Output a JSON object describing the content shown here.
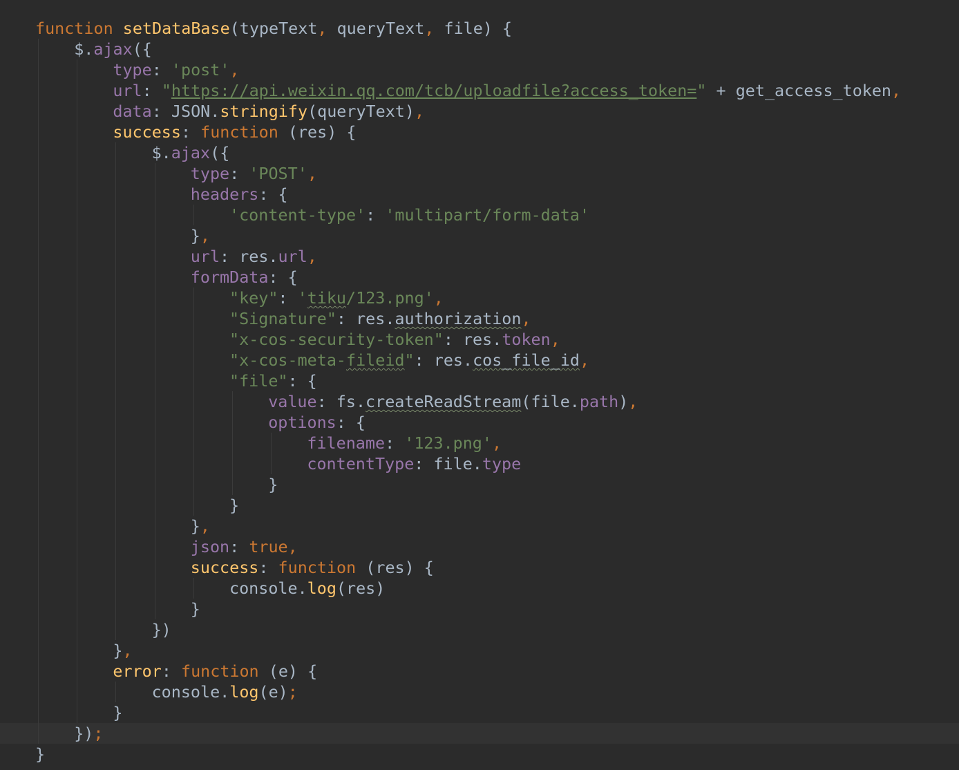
{
  "editor": {
    "theme": "darcula",
    "colors": {
      "background": "#2b2b2b",
      "current_line": "#323232",
      "keyword": "#cc7832",
      "function_name": "#ffc66d",
      "string": "#6a8759",
      "property": "#9876aa",
      "plain": "#a9b7c6"
    },
    "current_line_index": 34,
    "lines": [
      {
        "indent": 0,
        "tokens": [
          {
            "t": "function",
            "c": "kw"
          },
          {
            "t": " ",
            "c": "pl"
          },
          {
            "t": "setDataBase",
            "c": "fn"
          },
          {
            "t": "(typeText",
            "c": "pl"
          },
          {
            "t": ",",
            "c": "kw"
          },
          {
            "t": " queryText",
            "c": "pl"
          },
          {
            "t": ",",
            "c": "kw"
          },
          {
            "t": " file) {",
            "c": "pl"
          }
        ]
      },
      {
        "indent": 1,
        "tokens": [
          {
            "t": "$.",
            "c": "pl"
          },
          {
            "t": "ajax",
            "c": "prop"
          },
          {
            "t": "({",
            "c": "pl"
          }
        ]
      },
      {
        "indent": 2,
        "tokens": [
          {
            "t": "type",
            "c": "prop"
          },
          {
            "t": ": ",
            "c": "pl"
          },
          {
            "t": "'post'",
            "c": "str"
          },
          {
            "t": ",",
            "c": "kw"
          }
        ]
      },
      {
        "indent": 2,
        "tokens": [
          {
            "t": "url",
            "c": "prop"
          },
          {
            "t": ": ",
            "c": "pl"
          },
          {
            "t": "\"",
            "c": "str"
          },
          {
            "t": "https://api.weixin.qq.com/tcb/uploadfile?access_token=",
            "c": "url-link"
          },
          {
            "t": "\"",
            "c": "str"
          },
          {
            "t": " + get_access_token",
            "c": "pl"
          },
          {
            "t": ",",
            "c": "kw"
          }
        ]
      },
      {
        "indent": 2,
        "tokens": [
          {
            "t": "data",
            "c": "prop"
          },
          {
            "t": ": JSON.",
            "c": "pl"
          },
          {
            "t": "stringify",
            "c": "fn"
          },
          {
            "t": "(queryText)",
            "c": "pl"
          },
          {
            "t": ",",
            "c": "kw"
          }
        ]
      },
      {
        "indent": 2,
        "tokens": [
          {
            "t": "success",
            "c": "fn"
          },
          {
            "t": ": ",
            "c": "pl"
          },
          {
            "t": "function",
            "c": "kw"
          },
          {
            "t": " (res) {",
            "c": "pl"
          }
        ]
      },
      {
        "indent": 3,
        "tokens": [
          {
            "t": "$.",
            "c": "pl"
          },
          {
            "t": "ajax",
            "c": "prop"
          },
          {
            "t": "({",
            "c": "pl"
          }
        ]
      },
      {
        "indent": 4,
        "tokens": [
          {
            "t": "type",
            "c": "prop"
          },
          {
            "t": ": ",
            "c": "pl"
          },
          {
            "t": "'POST'",
            "c": "str"
          },
          {
            "t": ",",
            "c": "kw"
          }
        ]
      },
      {
        "indent": 4,
        "tokens": [
          {
            "t": "headers",
            "c": "prop"
          },
          {
            "t": ": {",
            "c": "pl"
          }
        ]
      },
      {
        "indent": 5,
        "tokens": [
          {
            "t": "'content-type'",
            "c": "str"
          },
          {
            "t": ": ",
            "c": "pl"
          },
          {
            "t": "'multipart/form-data'",
            "c": "str"
          }
        ]
      },
      {
        "indent": 4,
        "tokens": [
          {
            "t": "}",
            "c": "pl"
          },
          {
            "t": ",",
            "c": "kw"
          }
        ]
      },
      {
        "indent": 4,
        "tokens": [
          {
            "t": "url",
            "c": "prop"
          },
          {
            "t": ": res.",
            "c": "pl"
          },
          {
            "t": "url",
            "c": "prop"
          },
          {
            "t": ",",
            "c": "kw"
          }
        ]
      },
      {
        "indent": 4,
        "tokens": [
          {
            "t": "formData",
            "c": "prop"
          },
          {
            "t": ": {",
            "c": "pl"
          }
        ]
      },
      {
        "indent": 5,
        "tokens": [
          {
            "t": "\"key\"",
            "c": "str"
          },
          {
            "t": ": ",
            "c": "pl"
          },
          {
            "t": "'",
            "c": "str"
          },
          {
            "t": "tiku",
            "c": "str",
            "w": true
          },
          {
            "t": "/123.png'",
            "c": "str"
          },
          {
            "t": ",",
            "c": "kw"
          }
        ]
      },
      {
        "indent": 5,
        "tokens": [
          {
            "t": "\"Signature\"",
            "c": "str"
          },
          {
            "t": ": res.",
            "c": "pl"
          },
          {
            "t": "authorization",
            "c": "pl",
            "w": true
          },
          {
            "t": ",",
            "c": "kw"
          }
        ]
      },
      {
        "indent": 5,
        "tokens": [
          {
            "t": "\"x-cos-security-token\"",
            "c": "str"
          },
          {
            "t": ": res.",
            "c": "pl"
          },
          {
            "t": "token",
            "c": "prop"
          },
          {
            "t": ",",
            "c": "kw"
          }
        ]
      },
      {
        "indent": 5,
        "tokens": [
          {
            "t": "\"x-cos-meta-",
            "c": "str"
          },
          {
            "t": "fileid",
            "c": "str",
            "w": true
          },
          {
            "t": "\"",
            "c": "str"
          },
          {
            "t": ": res.",
            "c": "pl"
          },
          {
            "t": "cos_file_id",
            "c": "pl",
            "w": true
          },
          {
            "t": ",",
            "c": "kw"
          }
        ]
      },
      {
        "indent": 5,
        "tokens": [
          {
            "t": "\"file\"",
            "c": "str"
          },
          {
            "t": ": {",
            "c": "pl"
          }
        ]
      },
      {
        "indent": 6,
        "tokens": [
          {
            "t": "value",
            "c": "prop"
          },
          {
            "t": ": fs.",
            "c": "pl"
          },
          {
            "t": "createReadStream",
            "c": "pl",
            "w": true
          },
          {
            "t": "(file.",
            "c": "pl"
          },
          {
            "t": "path",
            "c": "prop"
          },
          {
            "t": ")",
            "c": "pl"
          },
          {
            "t": ",",
            "c": "kw"
          }
        ]
      },
      {
        "indent": 6,
        "tokens": [
          {
            "t": "options",
            "c": "prop"
          },
          {
            "t": ": {",
            "c": "pl"
          }
        ]
      },
      {
        "indent": 7,
        "tokens": [
          {
            "t": "filename",
            "c": "prop"
          },
          {
            "t": ": ",
            "c": "pl"
          },
          {
            "t": "'123.png'",
            "c": "str"
          },
          {
            "t": ",",
            "c": "kw"
          }
        ]
      },
      {
        "indent": 7,
        "tokens": [
          {
            "t": "contentType",
            "c": "prop"
          },
          {
            "t": ": file.",
            "c": "pl"
          },
          {
            "t": "type",
            "c": "prop"
          }
        ]
      },
      {
        "indent": 6,
        "tokens": [
          {
            "t": "}",
            "c": "pl"
          }
        ]
      },
      {
        "indent": 5,
        "tokens": [
          {
            "t": "}",
            "c": "pl"
          }
        ]
      },
      {
        "indent": 4,
        "tokens": [
          {
            "t": "}",
            "c": "pl"
          },
          {
            "t": ",",
            "c": "kw"
          }
        ]
      },
      {
        "indent": 4,
        "tokens": [
          {
            "t": "json",
            "c": "prop"
          },
          {
            "t": ": ",
            "c": "pl"
          },
          {
            "t": "true",
            "c": "kw"
          },
          {
            "t": ",",
            "c": "kw"
          }
        ]
      },
      {
        "indent": 4,
        "tokens": [
          {
            "t": "success",
            "c": "fn"
          },
          {
            "t": ": ",
            "c": "pl"
          },
          {
            "t": "function",
            "c": "kw"
          },
          {
            "t": " (res) {",
            "c": "pl"
          }
        ]
      },
      {
        "indent": 5,
        "tokens": [
          {
            "t": "console.",
            "c": "pl"
          },
          {
            "t": "log",
            "c": "fn"
          },
          {
            "t": "(res)",
            "c": "pl"
          }
        ]
      },
      {
        "indent": 4,
        "tokens": [
          {
            "t": "}",
            "c": "pl"
          }
        ]
      },
      {
        "indent": 3,
        "tokens": [
          {
            "t": "})",
            "c": "pl"
          }
        ]
      },
      {
        "indent": 2,
        "tokens": [
          {
            "t": "}",
            "c": "pl"
          },
          {
            "t": ",",
            "c": "kw"
          }
        ]
      },
      {
        "indent": 2,
        "tokens": [
          {
            "t": "error",
            "c": "fn"
          },
          {
            "t": ": ",
            "c": "pl"
          },
          {
            "t": "function",
            "c": "kw"
          },
          {
            "t": " (e) {",
            "c": "pl"
          }
        ]
      },
      {
        "indent": 3,
        "tokens": [
          {
            "t": "console.",
            "c": "pl"
          },
          {
            "t": "log",
            "c": "fn"
          },
          {
            "t": "(e)",
            "c": "pl"
          },
          {
            "t": ";",
            "c": "kw"
          }
        ]
      },
      {
        "indent": 2,
        "tokens": [
          {
            "t": "}",
            "c": "pl"
          }
        ]
      },
      {
        "indent": 1,
        "tokens": [
          {
            "t": "})",
            "c": "pl"
          },
          {
            "t": ";",
            "c": "kw"
          }
        ]
      },
      {
        "indent": 0,
        "tokens": [
          {
            "t": "}",
            "c": "pl"
          }
        ]
      }
    ]
  }
}
